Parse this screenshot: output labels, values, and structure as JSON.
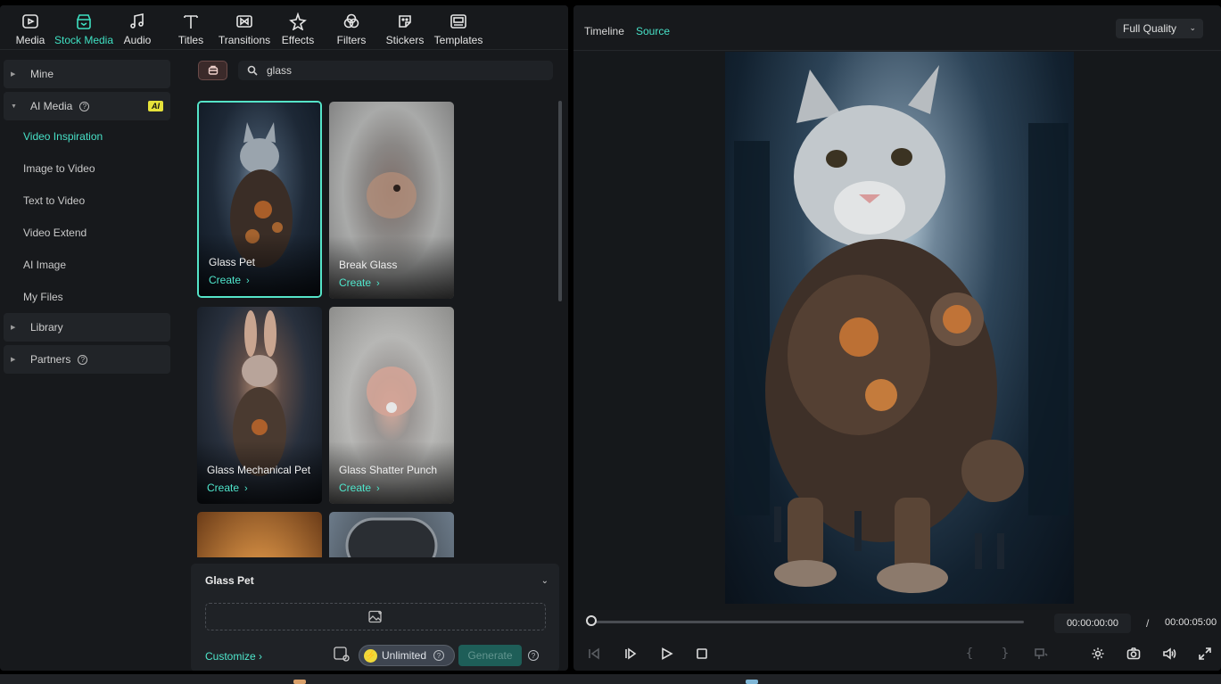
{
  "toolbar": {
    "items": [
      {
        "label": "Media",
        "icon": "media-icon"
      },
      {
        "label": "Stock Media",
        "icon": "stock-media-icon"
      },
      {
        "label": "Audio",
        "icon": "music-note-icon"
      },
      {
        "label": "Titles",
        "icon": "text-t-icon"
      },
      {
        "label": "Transitions",
        "icon": "transitions-icon"
      },
      {
        "label": "Effects",
        "icon": "effects-star-icon"
      },
      {
        "label": "Filters",
        "icon": "filters-icon"
      },
      {
        "label": "Stickers",
        "icon": "sticker-icon"
      },
      {
        "label": "Templates",
        "icon": "templates-icon"
      }
    ],
    "active": "Stock Media"
  },
  "sidebar": {
    "mine": "Mine",
    "ai_media": "AI Media",
    "ai_badge": "AI",
    "items": [
      "Video Inspiration",
      "Image to Video",
      "Text to Video",
      "Video Extend",
      "AI Image",
      "My Files"
    ],
    "library": "Library",
    "partners": "Partners"
  },
  "search": {
    "value": "glass"
  },
  "cards": [
    {
      "title": "Glass Pet",
      "action": "Create"
    },
    {
      "title": "Break Glass",
      "action": "Create"
    },
    {
      "title": "Glass Mechanical Pet",
      "action": "Create"
    },
    {
      "title": "Glass Shatter Punch",
      "action": "Create"
    }
  ],
  "generator": {
    "title": "Glass Pet",
    "customize": "Customize",
    "plan": "Unlimited",
    "generate": "Generate"
  },
  "preview": {
    "tabs": [
      "Timeline",
      "Source"
    ],
    "active_tab": "Source",
    "quality": "Full Quality",
    "current_time": "00:00:00:00",
    "separator": "/",
    "duration": "00:00:05:00",
    "progress": 0
  },
  "colors": {
    "accent": "#47e0c6",
    "panel": "#17191c",
    "ai_badge": "#e6e23a"
  }
}
